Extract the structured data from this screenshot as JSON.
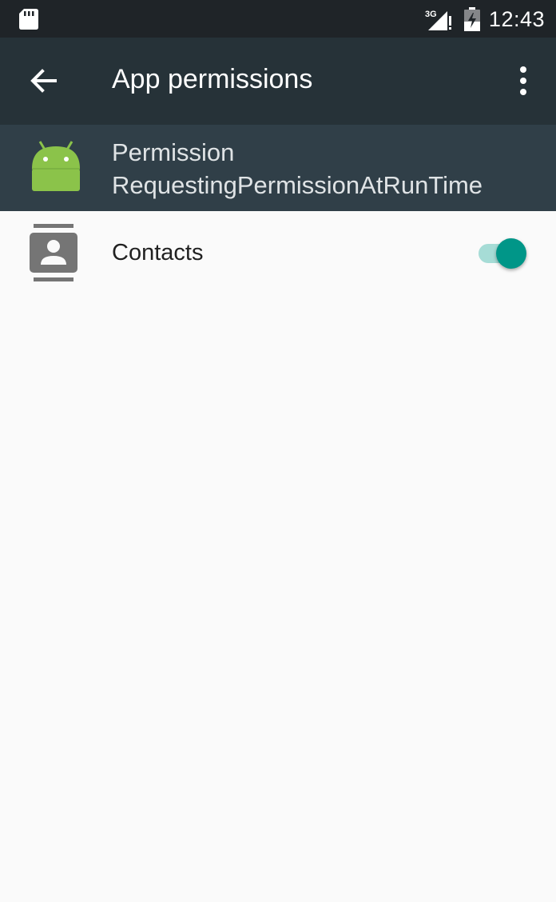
{
  "status_bar": {
    "time": "12:43",
    "network": "3G",
    "icons": [
      "sd-card-icon",
      "signal-3g-icon",
      "battery-icon"
    ]
  },
  "app_bar": {
    "title": "App permissions",
    "back_icon": "arrow-back-icon",
    "menu_icon": "more-vert-icon",
    "background": "#263238"
  },
  "app_header": {
    "app_name": "Permission\nRequestingPermissionAtRunTime",
    "icon": "android-icon",
    "background": "#303f48"
  },
  "permissions": [
    {
      "label": "Contacts",
      "icon": "contacts-icon",
      "enabled": true
    }
  ],
  "colors": {
    "accent": "#009688",
    "accent_track": "#a6dcd6",
    "android_green": "#8bc34a"
  }
}
